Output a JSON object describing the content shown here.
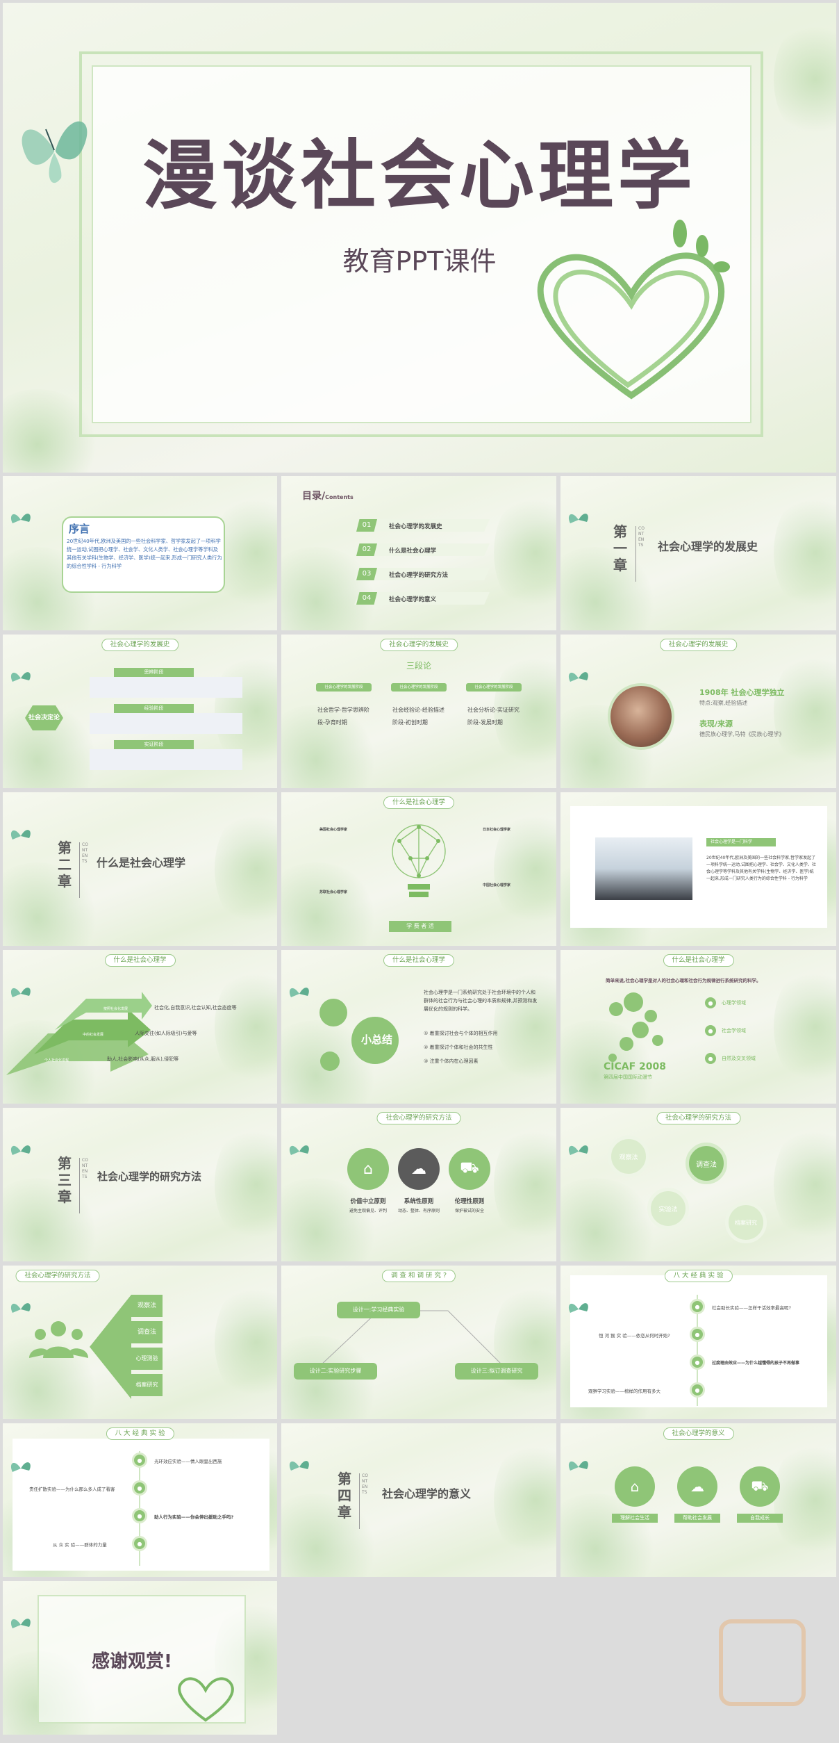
{
  "cover": {
    "title": "漫谈社会心理学",
    "subtitle": "教育PPT课件"
  },
  "preface": {
    "title": "序言",
    "body": "20世纪40年代,欧洲及美国的一些社会科学家、哲学家发起了一项科学统一运动,试图把心理学、社会学、文化人类学、社会心理学等学科及其他有关学科(生物学、经济学、医学)统一起来,形成一门研究人类行为的综合性学科 - 行为科学"
  },
  "toc": {
    "title": "目录/",
    "title_en": "Contents",
    "items": [
      {
        "num": "01",
        "label": "社会心理学的发展史"
      },
      {
        "num": "02",
        "label": "什么是社会心理学"
      },
      {
        "num": "03",
        "label": "社会心理学的研究方法"
      },
      {
        "num": "04",
        "label": "社会心理学的意义"
      }
    ]
  },
  "ch1": {
    "chapter": "第一章",
    "contents": "CONTENTS",
    "title": "社会心理学的发展史"
  },
  "ch2": {
    "chapter": "第二章",
    "contents": "CONTENTS",
    "title": "什么是社会心理学"
  },
  "ch3": {
    "chapter": "第三章",
    "contents": "CONTENTS",
    "title": "社会心理学的研究方法"
  },
  "ch4": {
    "chapter": "第四章",
    "contents": "CONTENTS",
    "title": "社会心理学的意义"
  },
  "dev": {
    "pill": "社会心理学的发展史",
    "hex": "社会决定论",
    "tabs": [
      "思辨阶段",
      "经验阶段",
      "实证阶段"
    ],
    "three": "三段论",
    "cols": [
      {
        "head": "社会心理学的发展阶段",
        "body": "社会哲学-哲学思辨阶段-孕育时期"
      },
      {
        "head": "社会心理学的发展阶段",
        "body": "社会经验论-经验描述阶段-初创时期"
      },
      {
        "head": "社会心理学的发展阶段",
        "body": "社会分析论-实证研究阶段-发展时期"
      }
    ],
    "year": "1908年 社会心理学独立",
    "year_sub": "特点:观察,经验描述",
    "rep": "表现/来源",
    "rep_sub": "德民族心理学,马特《民族心理学》"
  },
  "what": {
    "pill": "什么是社会心理学",
    "bulb": "学 费 者 活",
    "heads": [
      "美国社会心理学家",
      "日本社会心理学家",
      "苏联社会心理学家",
      "中国社会心理学家"
    ],
    "sum": "小总结",
    "sum_body": "社会心理学是一门系统研究处于社会环境中的个人和群体的社会行为与社会心理的本质和规律,并预测和发展优化的规则的科学。",
    "sum_items": [
      "① 着重探讨社会与个体的相互作用",
      "② 着重探讨个体和社会的共生性",
      "③ 注重个体内在心理因素"
    ],
    "photo_head": "社会心理学是一门科学",
    "photo_body": "20世纪40年代,欧洲及美国的一些社会科学家,哲学家发起了一项科学统一运动,试图把心理学、社会学、文化人类学、社会心理学等学科及其他有关学科(生物学、经济学、医学)统一起来,形成一门研究人类行为的综合性学科 - 行为科学",
    "arrows": [
      "按照社会化发展",
      "中的社会发展",
      "个人社会化进程"
    ],
    "arrow_texts": [
      "社会化,自我意识,社会认知,社会态度等",
      "人际交往(如人际吸引)与爱等",
      "助人,社会影响(从众,服从),侵犯等"
    ],
    "cicaf": "CICAF 2008",
    "cicaf_sub": "第四届中国国际动漫节",
    "map_lead": "简单来说,社会心理学是对人的社会心理和社会行为规律进行系统研究的科学。",
    "map_items": [
      "心理学领域",
      "社会学领域",
      "自然及交叉领域"
    ]
  },
  "method": {
    "pill": "社会心理学的研究方法",
    "principles": [
      {
        "name": "价值中立原则",
        "desc": "避免主观偏见、评判"
      },
      {
        "name": "系统性原则",
        "desc": "动态、整体、有序原则"
      },
      {
        "name": "伦理性原则",
        "desc": "保护被试的安全"
      }
    ],
    "bubbles": [
      "观察法",
      "调查法",
      "实验法",
      "档案研究"
    ],
    "tree": [
      "观察法",
      "调查法",
      "心理测验",
      "档案研究"
    ],
    "design_pill": "调 查 和 调 研 究 ?",
    "design": [
      "设计一:学习经典实验",
      "设计二:实验研究步骤",
      "设计三:拟订调查研究"
    ]
  },
  "exp": {
    "pill": "八 大 经 典 实 验",
    "a": [
      "社会助长实验——怎样干活效率最高呢?",
      "恒 河 猴 实 验——依恋从何时开始?",
      "过度理由效应——为什么越懂得的孩子不再做事",
      "观察学习实验——榜样的作用有多大"
    ],
    "b": [
      "责任扩散实验——为什么那么多人成了看客",
      "光环效应实验——情人眼里出西施",
      "助人行为实验——你会伸出援助之手吗?",
      "从 众 实 验——群体的力量"
    ]
  },
  "meaning": {
    "pill": "社会心理学的意义",
    "items": [
      "理解社会生活",
      "帮助社会发展",
      "自我成长"
    ]
  },
  "thanks": {
    "text": "感谢观赏!"
  }
}
